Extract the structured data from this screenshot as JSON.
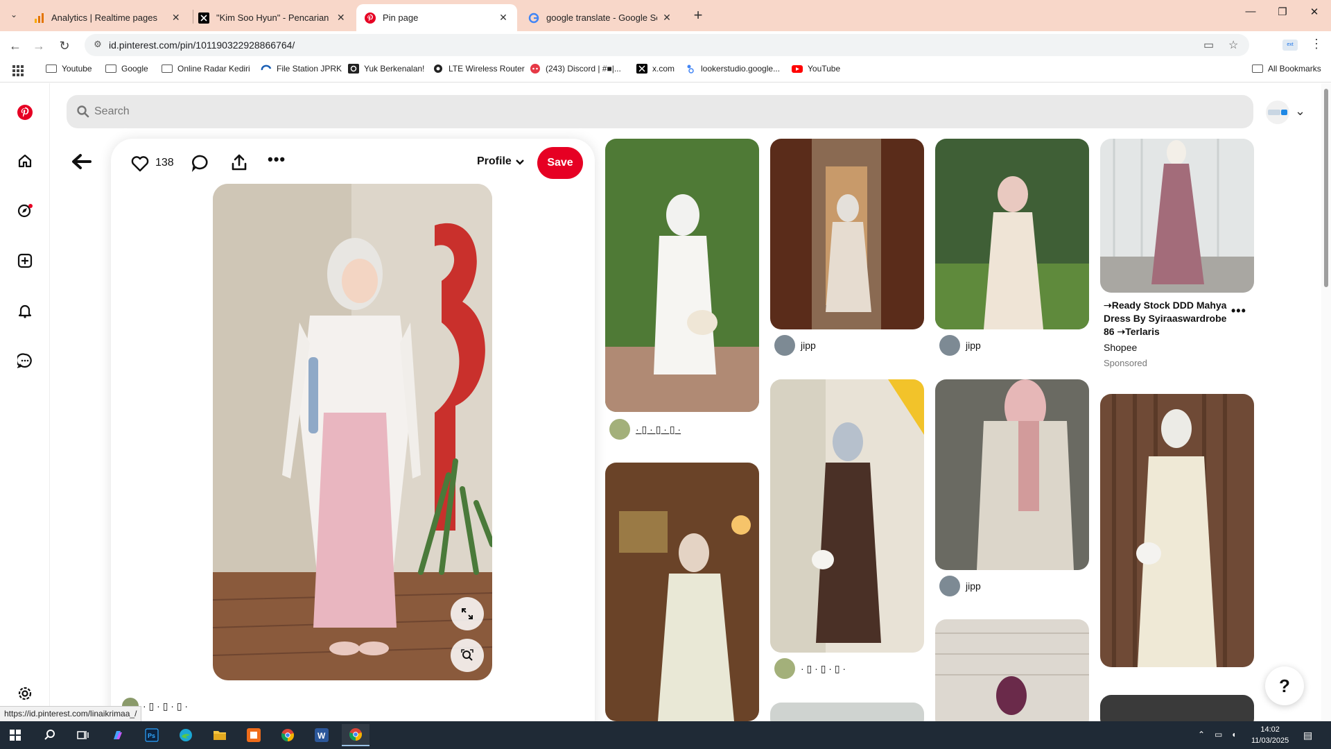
{
  "browser": {
    "tabs": [
      {
        "title": "Analytics | Realtime pages",
        "active": false
      },
      {
        "title": "\"Kim Soo Hyun\" - Pencarian / X",
        "active": false
      },
      {
        "title": "Pin page",
        "active": true
      },
      {
        "title": "google translate - Google Search",
        "active": false
      }
    ],
    "url": "id.pinterest.com/pin/101190322928866764/",
    "status_url": "https://id.pinterest.com/linaikrimaa_/",
    "bookmarks": [
      {
        "label": "Youtube",
        "icon": "folder-icon"
      },
      {
        "label": "Google",
        "icon": "folder-icon"
      },
      {
        "label": "Online Radar Kediri",
        "icon": "folder-icon"
      },
      {
        "label": "File Station JPRK",
        "icon": "file-station-icon"
      },
      {
        "label": "Yuk Berkenalan!",
        "icon": "q-icon"
      },
      {
        "label": "LTE Wireless Router",
        "icon": "router-icon"
      },
      {
        "label": "(243) Discord | #■|...",
        "icon": "discord-icon"
      },
      {
        "label": "x.com",
        "icon": "x-icon"
      },
      {
        "label": "lookerstudio.google...",
        "icon": "looker-icon"
      },
      {
        "label": "YouTube",
        "icon": "youtube-icon"
      }
    ],
    "all_bookmarks": "All Bookmarks"
  },
  "pinterest": {
    "search_placeholder": "Search",
    "pin": {
      "like_count": "138",
      "profile_label": "Profile",
      "save_label": "Save",
      "author": "· ▯ · ▯ · ▯ ·"
    },
    "grid": [
      {
        "author": "· ▯ · ▯ · ▯ ·"
      },
      {
        "author": "jipp"
      },
      {
        "author": "jipp"
      },
      {
        "author": "· ▯ · ▯ · ▯ ·"
      },
      {
        "author": "jipp"
      }
    ],
    "sponsored": {
      "title": "➝Ready Stock DDD Mahya Dress By Syiraaswardrobe 86 ➝Terlaris",
      "seller": "Shopee",
      "tag": "Sponsored"
    },
    "help_label": "?",
    "colors": {
      "brand": "#e60023"
    }
  },
  "taskbar": {
    "time": "14:02",
    "date": "11/03/2025"
  }
}
